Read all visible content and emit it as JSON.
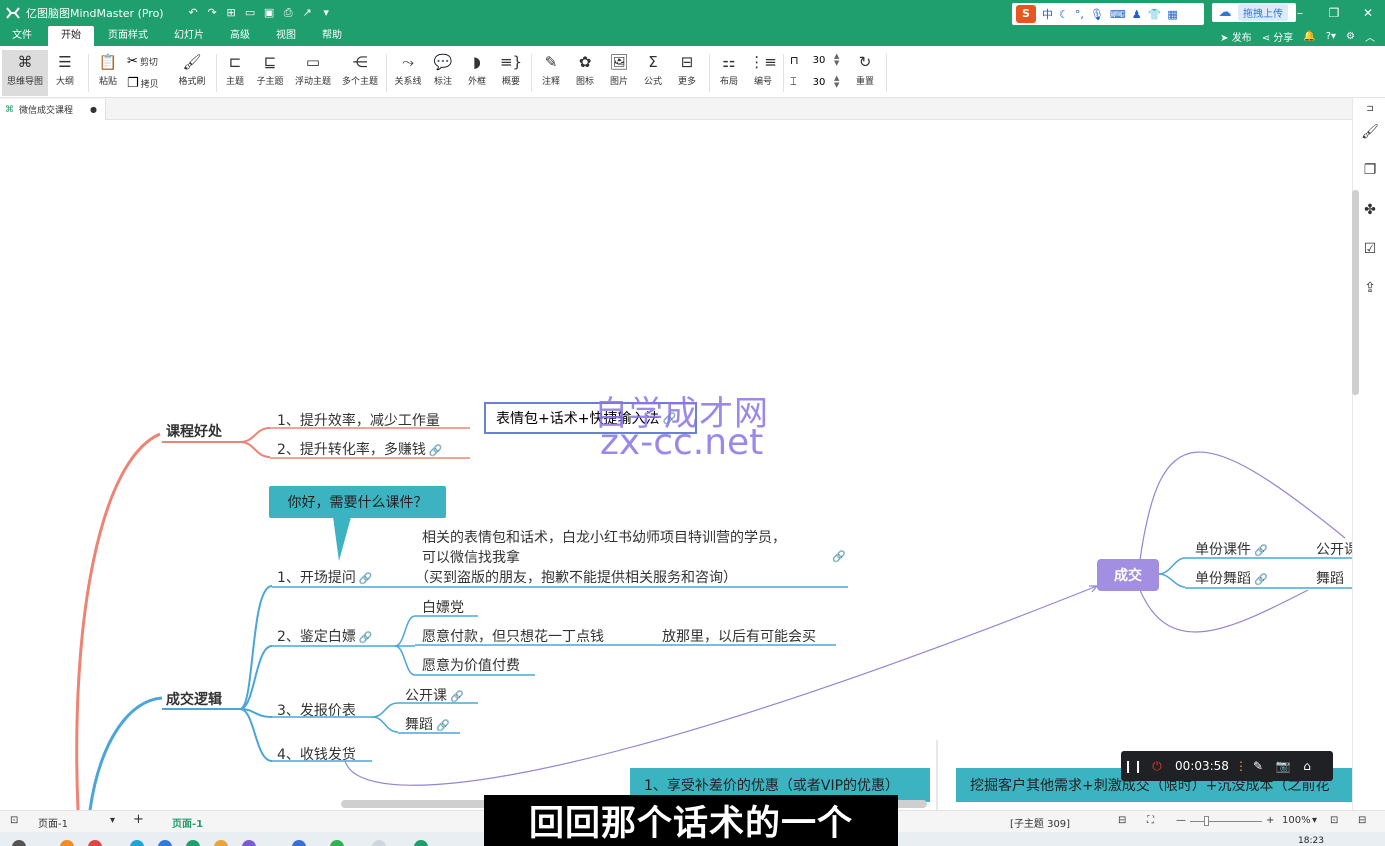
{
  "app": {
    "title": "亿图脑图MindMaster (Pro)",
    "accent": "#1f9e6e"
  },
  "titlebar": {
    "undo_icon": "undo-icon",
    "redo_icon": "redo-icon",
    "upload_label": "拖拽上传",
    "tray_lang": "中"
  },
  "menu": {
    "tabs": [
      "文件",
      "开始",
      "页面样式",
      "幻灯片",
      "高级",
      "视图",
      "帮助"
    ],
    "active": "开始",
    "publish": "发布",
    "share": "分享"
  },
  "ribbon": {
    "mindmap": "思维导图",
    "outline": "大纲",
    "paste": "粘贴",
    "cut": "剪切",
    "copy": "拷贝",
    "format_painter": "格式刷",
    "topic": "主题",
    "subtopic": "子主题",
    "floating": "浮动主题",
    "multi": "多个主题",
    "relation": "关系线",
    "callout": "标注",
    "boundary": "外框",
    "summary": "概要",
    "note": "注释",
    "icon": "图标",
    "picture": "图片",
    "formula": "公式",
    "more": "更多",
    "layout": "布局",
    "numbering": "编号",
    "h_spacing": "30",
    "v_spacing": "30",
    "reset": "重置"
  },
  "doc_tab": {
    "name": "微信成交课程"
  },
  "mindmap": {
    "benefits": {
      "title": "课程好处",
      "items": [
        "1、提升效率，减少工作量",
        "2、提升转化率，多赚钱"
      ],
      "selected_text": "表情包+话术+快捷输入法"
    },
    "callout": "你好，需要什么课件？",
    "logic": {
      "title": "成交逻辑",
      "steps": [
        "1、开场提问",
        "2、鉴定白嫖",
        "3、发报价表",
        "4、收钱发货"
      ],
      "opening_text_1": "相关的表情包和话术，白龙小红书幼师项目特训营的学员，",
      "opening_text_2": "可以微信找我拿",
      "opening_text_3": "（买到盗版的朋友，抱歉不能提供相关服务和咨询）",
      "freeloader": [
        "白嫖党",
        "愿意付款，但只想花一丁点钱",
        "愿意为价值付费"
      ],
      "freeloader_note": "放那里，以后有可能会买",
      "price": [
        "公开课",
        "舞蹈"
      ]
    },
    "deal": {
      "title": "成交",
      "items": [
        "单份课件",
        "单份舞蹈"
      ],
      "right_items": [
        "公开课",
        "舞蹈"
      ]
    },
    "bottom_box_1": "1、享受补差价的优惠（或者VIP的优惠）",
    "bottom_box_2": "挖掘客户其他需求+刺激成交（限时）+沉没成本（之前花"
  },
  "watermark": {
    "line1": "自学成才网",
    "line2": "zx-cc.net"
  },
  "recorder": {
    "time": "00:03:58"
  },
  "subtitle": "回回那个话术的一个",
  "statusbar": {
    "page_select": "页面-1",
    "page_tab": "页面-1",
    "subtopic_count": "[子主题 309]",
    "zoom": "100%"
  },
  "taskbar": {
    "clock": "18:23"
  }
}
